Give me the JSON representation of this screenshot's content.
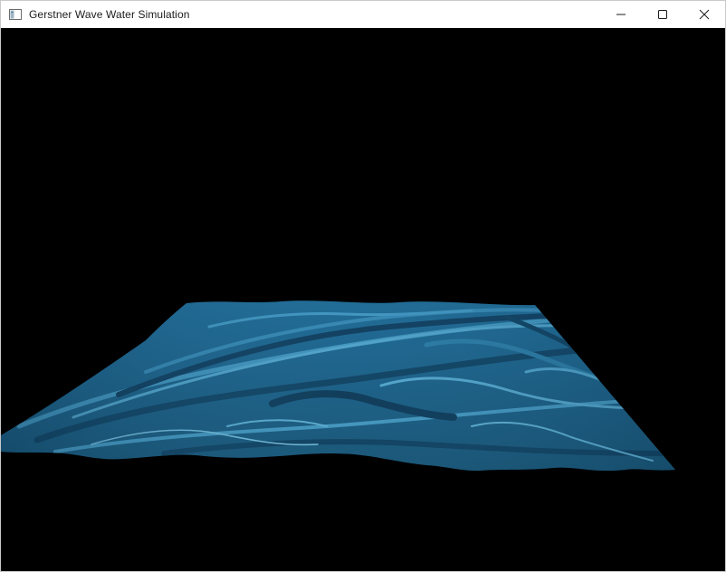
{
  "window": {
    "title": "Gerstner Wave Water Simulation",
    "icon": "app-window-icon",
    "controls": {
      "minimize_icon": "minimize-icon",
      "maximize_icon": "maximize-icon",
      "close_icon": "close-icon"
    }
  },
  "scene": {
    "background_color": "#000000",
    "water_base_color": "#1c5f86",
    "water_highlight_color": "#4a9ec6",
    "water_dark_color": "#0f3a57"
  }
}
